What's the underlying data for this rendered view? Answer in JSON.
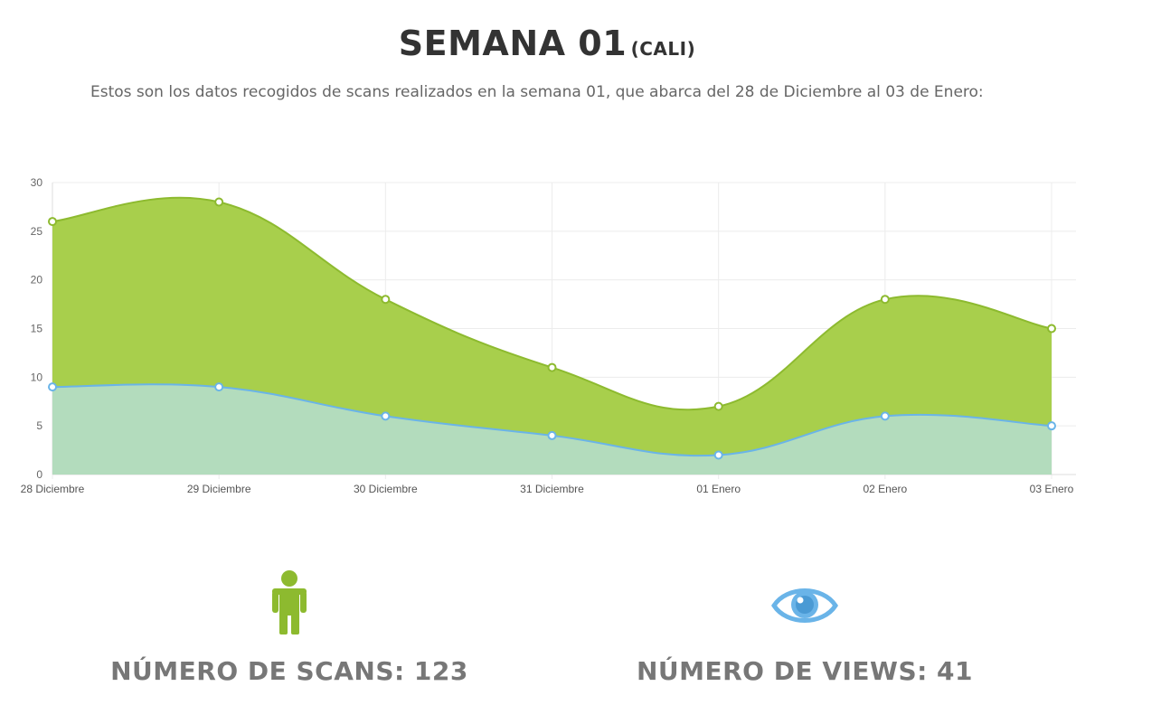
{
  "header": {
    "title": "SEMANA 01",
    "title_suffix": "(CALI)",
    "description": "Estos son los datos recogidos de scans realizados en la semana 01, que abarca del 28 de Diciembre al 03 de Enero:"
  },
  "chart_data": {
    "type": "area",
    "categories": [
      "28 Diciembre",
      "29 Diciembre",
      "30 Diciembre",
      "31 Diciembre",
      "01 Enero",
      "02 Enero",
      "03 Enero"
    ],
    "series": [
      {
        "values": [
          26,
          28,
          18,
          11,
          7,
          18,
          15
        ],
        "color": "#a8cf4c",
        "stroke": "#8dba2f"
      },
      {
        "values": [
          9,
          9,
          6,
          4,
          2,
          6,
          5
        ],
        "color": "#b3dcbd",
        "stroke": "#6ab4e8"
      }
    ],
    "ylim": [
      0,
      30
    ],
    "yticks": [
      0,
      5,
      10,
      15,
      20,
      25,
      30
    ],
    "grid": true,
    "xlabel": "",
    "ylabel": ""
  },
  "stats": {
    "scans": {
      "label": "NÚMERO DE SCANS: 123",
      "icon": "person-icon",
      "color": "#8dba2f"
    },
    "views": {
      "label": "NÚMERO DE VIEWS: 41",
      "icon": "eye-icon",
      "color": "#6ab4e8"
    }
  }
}
